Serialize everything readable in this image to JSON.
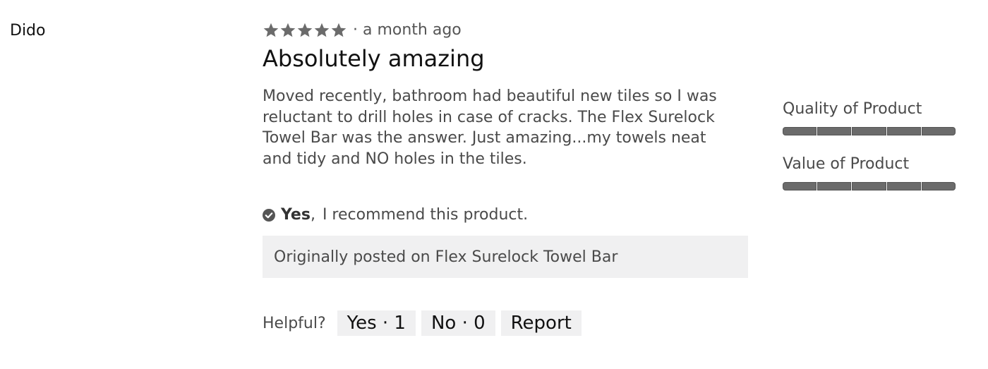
{
  "review": {
    "author": "Dido",
    "rating": 5,
    "rating_max": 5,
    "star_color": "#6b6b6b",
    "date": "· a month ago",
    "title": "Absolutely amazing",
    "body": "Moved recently, bathroom had beautiful new tiles so I was reluctant to drill holes in case of cracks. The Flex Surelock Towel Bar was the answer. Just amazing...my towels neat and tidy and NO holes in the tiles.",
    "recommend": {
      "yes": "Yes",
      "comma": ",",
      "text": "I recommend this product."
    },
    "origin": "Originally posted on Flex Surelock Towel Bar",
    "helpful": {
      "label": "Helpful?",
      "yes_button": "Yes · 1",
      "no_button": "No · 0",
      "report_button": "Report"
    }
  },
  "ratings": [
    {
      "label": "Quality of Product",
      "value": 5,
      "max": 5
    },
    {
      "label": "Value of Product",
      "value": 5,
      "max": 5
    }
  ],
  "icons": {
    "star": "star-icon",
    "check": "check-circle-icon"
  }
}
